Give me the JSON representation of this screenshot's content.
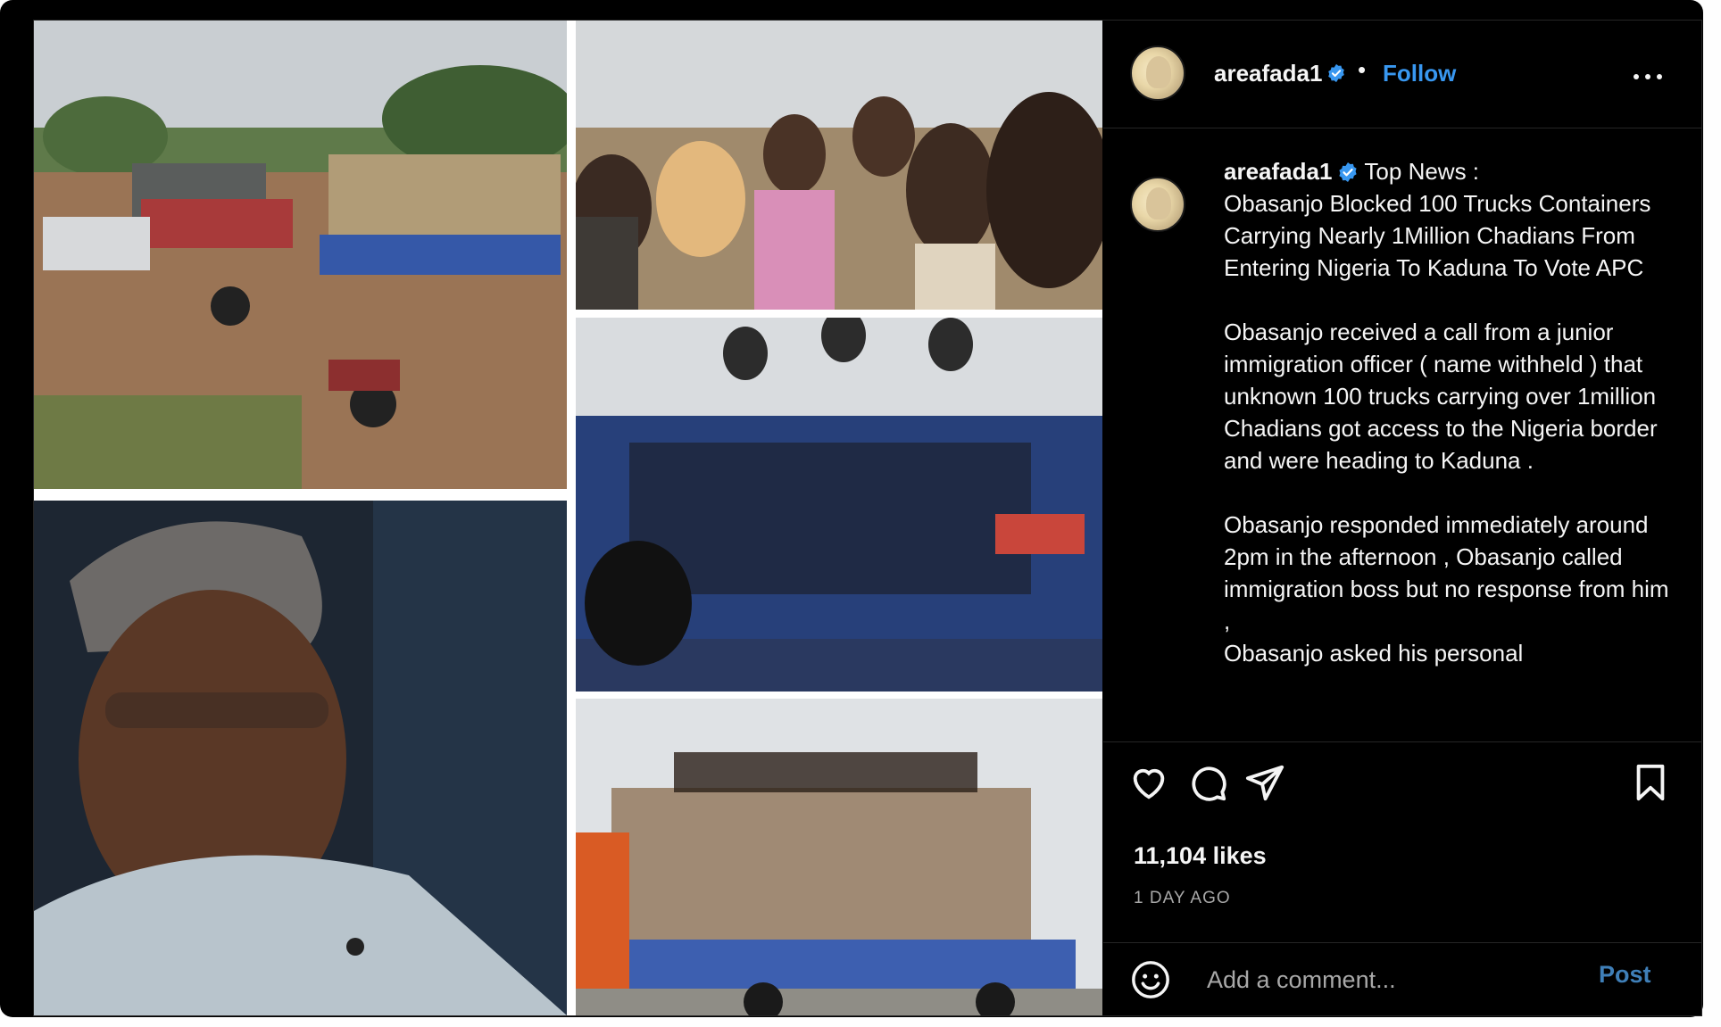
{
  "header": {
    "username": "areafada1",
    "follow_label": "Follow",
    "separator": "•"
  },
  "caption": {
    "username": "areafada1",
    "text": "Top News :\nObasanjo Blocked 100 Trucks Containers Carrying Nearly 1Million Chadians From Entering Nigeria To Kaduna To Vote APC\n\nObasanjo received a call from a junior immigration officer ( name withheld ) that unknown 100 trucks carrying over 1million Chadians got access to the Nigeria border and were heading to Kaduna .\n\nObasanjo responded immediately around 2pm in the afternoon , Obasanjo called immigration boss but no response from him ,\nObasanjo asked his personal"
  },
  "stats": {
    "likes": "11,104 likes",
    "time": "1 DAY AGO"
  },
  "comment": {
    "placeholder": "Add a comment...",
    "post_label": "Post"
  },
  "icons": {
    "header": [
      "verified-badge-icon",
      "more-options-icon"
    ],
    "actions": [
      "heart-icon",
      "comment-icon",
      "share-icon",
      "bookmark-icon",
      "emoji-icon"
    ]
  },
  "colors": {
    "background": "#000000",
    "text": "#f5f5f5",
    "muted": "#a8a8a8",
    "link": "#3897f0",
    "verified": "#3897f0",
    "divider": "#262626"
  }
}
